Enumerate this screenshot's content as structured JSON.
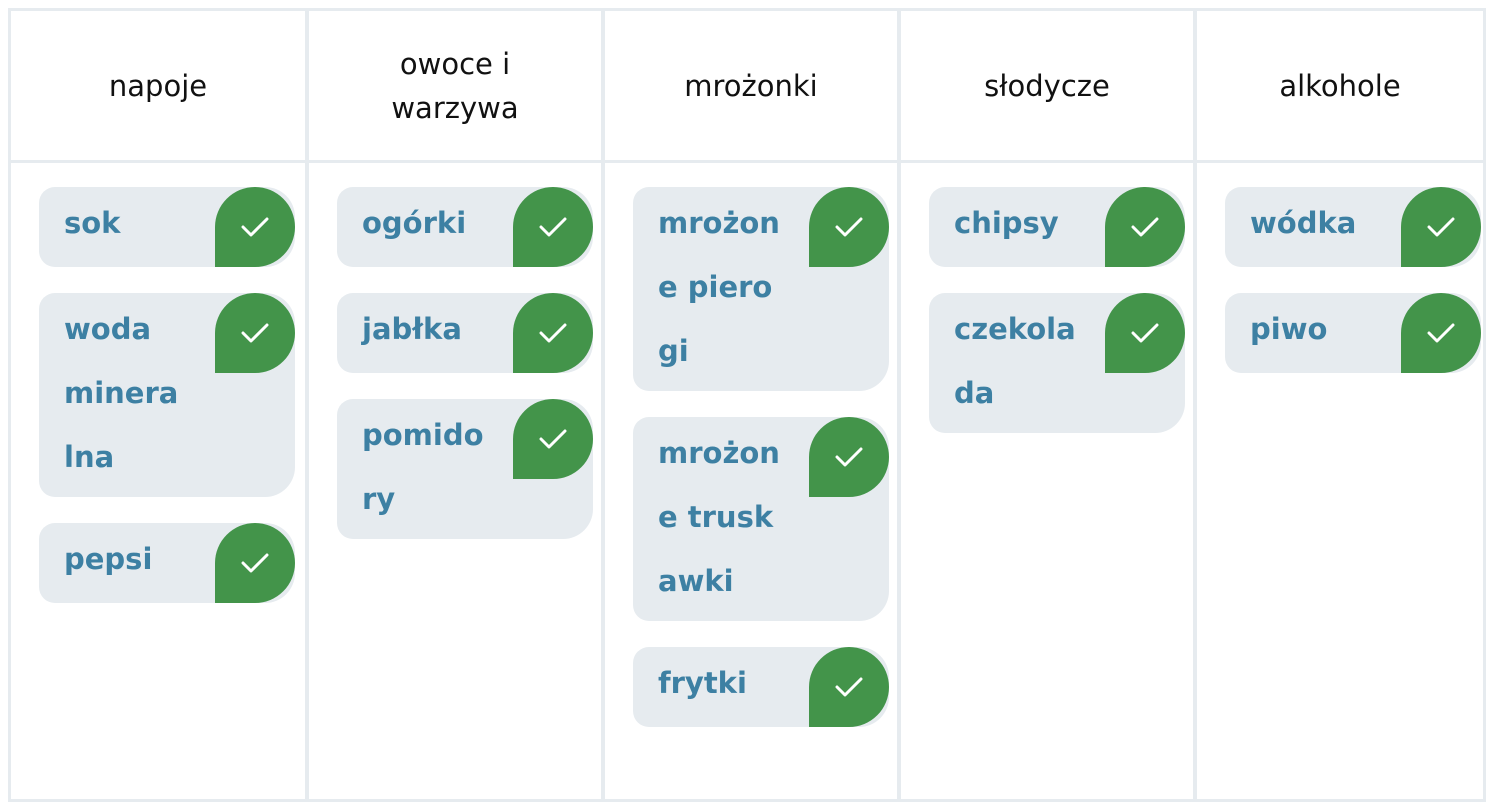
{
  "board": {
    "columns": [
      {
        "title": "napoje",
        "items": [
          "sok",
          "woda mineralna",
          "pepsi"
        ]
      },
      {
        "title": "owoce i warzywa",
        "items": [
          "ogórki",
          "jabłka",
          "pomidory"
        ]
      },
      {
        "title": "mrożonki",
        "items": [
          "mrożone pierogi",
          "mrożone truskawki",
          "frytki"
        ]
      },
      {
        "title": "słodycze",
        "items": [
          "chipsy",
          "czekolada"
        ]
      },
      {
        "title": "alkohole",
        "items": [
          "wódka",
          "piwo"
        ]
      }
    ]
  },
  "icons": {
    "tile_action": "check-icon"
  },
  "colors": {
    "check_bg": "#43944a",
    "tile_bg": "#e6ebef",
    "tile_text": "#3d80a3",
    "header_text": "#111111",
    "grid_border": "#e6ebef"
  }
}
